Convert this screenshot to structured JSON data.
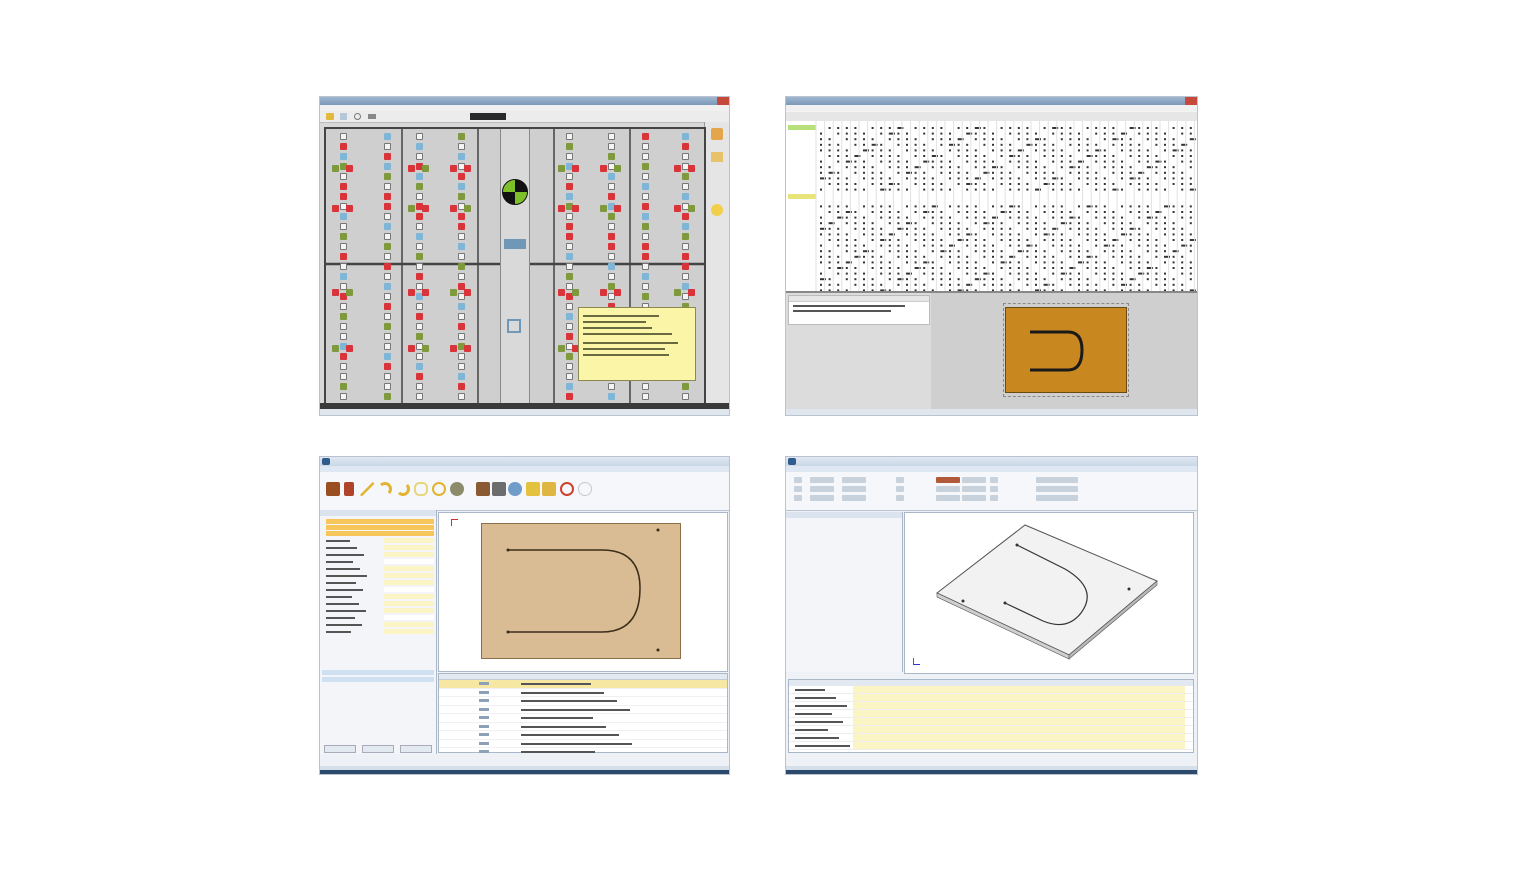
{
  "screens": {
    "s1": {
      "window_title": "",
      "tooltip_title": "",
      "tooltip_lines": [
        "",
        "",
        "",
        "",
        "",
        "",
        ""
      ]
    },
    "s2": {
      "window_title": "",
      "grid_header": "",
      "first_group": "",
      "second_group": ""
    },
    "s3": {
      "window_title": "",
      "menu": [
        "",
        "",
        "",
        "",
        ""
      ],
      "prop_labels": [
        "",
        "",
        "",
        "",
        "",
        "",
        "",
        ""
      ],
      "prop_values": [
        "",
        "",
        "",
        "",
        "",
        "",
        "",
        ""
      ],
      "list_rows": [
        "",
        "",
        "",
        "",
        "",
        "",
        "",
        "",
        ""
      ],
      "buttons": [
        "",
        "",
        ""
      ]
    },
    "s4": {
      "window_title": "",
      "menu": [
        "",
        "",
        "",
        "",
        ""
      ],
      "params_title": "",
      "param_labels": [
        "",
        "",
        "",
        "",
        "",
        "",
        "",
        ""
      ]
    }
  },
  "colors": {
    "panel_bg": "#cfcfcf",
    "red_tile": "#d8343a",
    "green_tile": "#7e9a3c",
    "blue_tile": "#7fb5d7",
    "panel_brown": "#c9871f",
    "panel_tan": "#d9bc93",
    "tooltip_bg": "#fbf5a8",
    "highlight_row": "#f6c65b",
    "title_bar": "#8ca6c4"
  },
  "icons": [
    "folder-icon",
    "save-icon",
    "undo-icon",
    "arrow-icon",
    "target-icon",
    "lock-icon",
    "hand-icon",
    "close-icon"
  ]
}
